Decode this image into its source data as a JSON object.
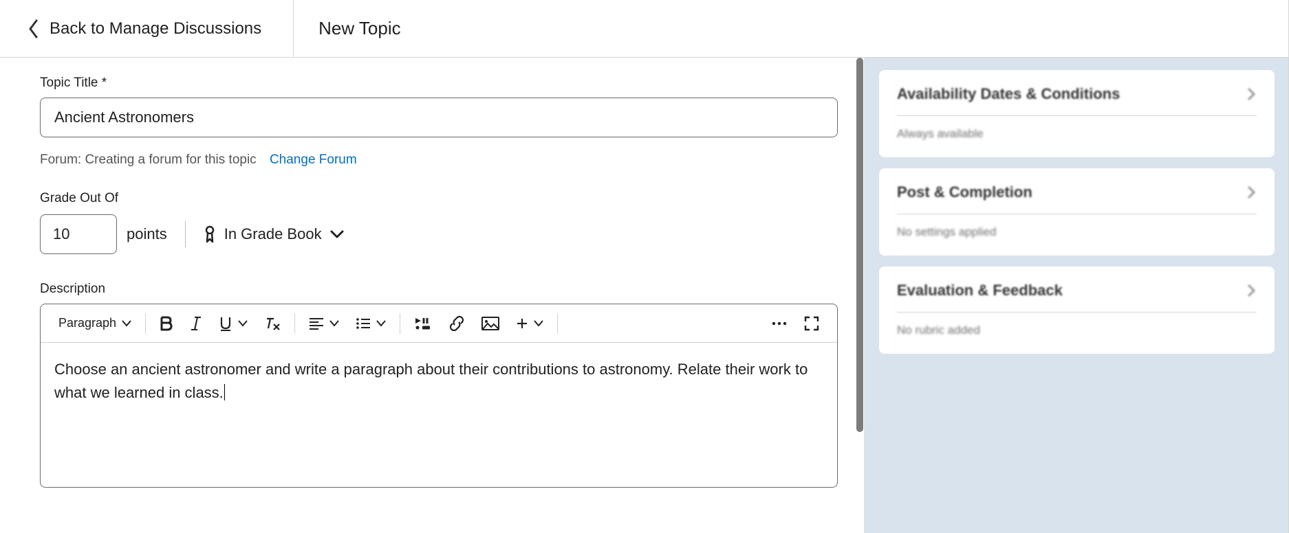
{
  "header": {
    "back_label": "Back to Manage Discussions",
    "page_title": "New Topic"
  },
  "form": {
    "topic_title_label": "Topic Title *",
    "topic_title_value": "Ancient Astronomers",
    "forum_prefix": "Forum: Creating a forum for this topic",
    "change_forum_label": "Change Forum",
    "grade_label": "Grade Out Of",
    "grade_value": "10",
    "points_label": "points",
    "in_grade_book_label": "In Grade Book",
    "description_label": "Description",
    "description_text": "Choose an ancient astronomer and write a paragraph about their contributions to astronomy. Relate their work to what we learned in class."
  },
  "editor": {
    "block_style": "Paragraph"
  },
  "side": {
    "availability": {
      "title": "Availability Dates & Conditions",
      "subtitle": "Always available"
    },
    "post": {
      "title": "Post & Completion",
      "subtitle": "No settings applied"
    },
    "eval": {
      "title": "Evaluation & Feedback",
      "subtitle": "No rubric added"
    }
  }
}
